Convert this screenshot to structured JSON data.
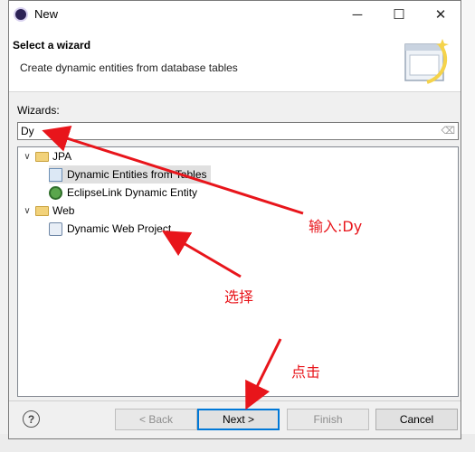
{
  "window": {
    "title": "New",
    "minimize_glyph": "─",
    "maximize_glyph": "☐",
    "close_glyph": "✕"
  },
  "header": {
    "title": "Select a wizard",
    "description": "Create dynamic entities from database tables"
  },
  "filter": {
    "label": "Wizards:",
    "value": "Dy",
    "clear_icon": "eraser-icon",
    "clear_glyph": "⌫"
  },
  "tree": {
    "groups": [
      {
        "label": "JPA",
        "expanded": true,
        "items": [
          {
            "label": "Dynamic Entities from Tables",
            "icon": "jpa-entities-icon",
            "selected": true
          },
          {
            "label": "EclipseLink Dynamic Entity",
            "icon": "eclipselink-icon",
            "selected": false
          }
        ]
      },
      {
        "label": "Web",
        "expanded": true,
        "items": [
          {
            "label": "Dynamic Web Project",
            "icon": "web-project-icon",
            "selected": false
          }
        ]
      }
    ],
    "expand_glyph": "∨"
  },
  "buttons": {
    "help": "?",
    "back": "< Back",
    "next": "Next >",
    "finish": "Finish",
    "cancel": "Cancel"
  },
  "annotations": {
    "input": "输入:Dy",
    "select": "选择",
    "click": "点击",
    "color": "#e8151b"
  }
}
